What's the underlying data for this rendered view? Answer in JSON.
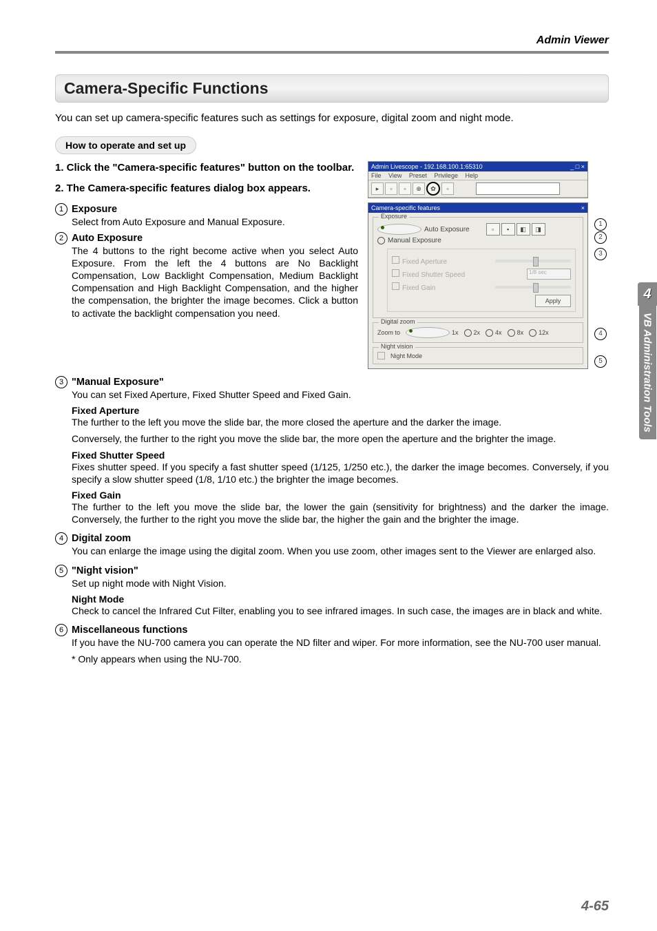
{
  "header_right": "Admin Viewer",
  "section_title": "Camera-Specific Functions",
  "intro": "You can set up camera-specific features such as settings for exposure, digital zoom and night mode.",
  "howto": "How to operate and set up",
  "steps": {
    "s1": "1.  Click the \"Camera-specific features\" button on the toolbar.",
    "s2": "2.  The Camera-specific features dialog box appears."
  },
  "items": {
    "i1_title": "Exposure",
    "i1_body": "Select from Auto Exposure and Manual Exposure.",
    "i2_title": "Auto Exposure",
    "i2_body": "The 4 buttons to the right become active when you select Auto Exposure. From the left the 4 buttons are No Backlight Compensation, Low Backlight Compensation, Medium Backlight Compensation and High Backlight Compensation, and the higher the compensation, the brighter the image becomes. Click a button to activate the backlight compensation you need.",
    "i3_title": "\"Manual Exposure\"",
    "i3_lead": "You can set Fixed Aperture, Fixed Shutter Speed and Fixed Gain.",
    "fa_h": "Fixed Aperture",
    "fa_p1": "The further to the left you move the slide bar, the more closed the aperture and the darker the image.",
    "fa_p2": "Conversely, the further to the right you move the slide bar, the more open the aperture and the brighter the image.",
    "fs_h": "Fixed Shutter Speed",
    "fs_p": "Fixes shutter speed. If you specify a fast shutter speed (1/125, 1/250 etc.), the darker the image becomes. Conversely, if you specify a slow shutter speed (1/8, 1/10 etc.) the brighter the image becomes.",
    "fg_h": "Fixed Gain",
    "fg_p": "The further to the left you move the slide bar, the lower the gain (sensitivity for brightness) and the darker the image. Conversely, the further to the right you move the slide bar, the higher the gain and the brighter the image.",
    "i4_title": "Digital zoom",
    "i4_body": "You can enlarge the image using the digital zoom. When you use zoom, other images sent to the Viewer are enlarged also.",
    "i5_title": "\"Night vision\"",
    "i5_lead": "Set up night mode with Night Vision.",
    "nm_h": "Night Mode",
    "nm_p": "Check to cancel the Infrared Cut Filter, enabling you to see infrared images. In such case, the images are in black and white.",
    "i6_title": "Miscellaneous functions",
    "i6_body": "If you have the NU-700 camera you can operate the ND filter and wiper. For more information, see the NU-700 user manual.",
    "i6_note": "* Only appears when using the NU-700."
  },
  "screenshot": {
    "main_title": "Admin Livescope - 192.168.100.1:65310",
    "menu": {
      "file": "File",
      "view": "View",
      "preset": "Preset",
      "priv": "Privilege",
      "help": "Help"
    },
    "dlg_title": "Camera-specific features",
    "grp_exposure": "Exposure",
    "auto_exp": "Auto Exposure",
    "manual_exp": "Manual Exposure",
    "fixed_aperture": "Fixed Aperture",
    "fixed_shutter": "Fixed Shutter Speed",
    "shutter_val": "1/8 sec",
    "fixed_gain": "Fixed Gain",
    "apply": "Apply",
    "grp_zoom": "Digital zoom",
    "zoom_to": "Zoom to",
    "zoom_opts": {
      "z1": "1x",
      "z2": "2x",
      "z4": "4x",
      "z8": "8x",
      "z12": "12x"
    },
    "grp_night": "Night vision",
    "night_mode": "Night Mode",
    "close_x": "×",
    "minmax": "_ □ ×"
  },
  "tab": {
    "num": "4",
    "text": "VB Administration Tools"
  },
  "page_num": "4-65"
}
